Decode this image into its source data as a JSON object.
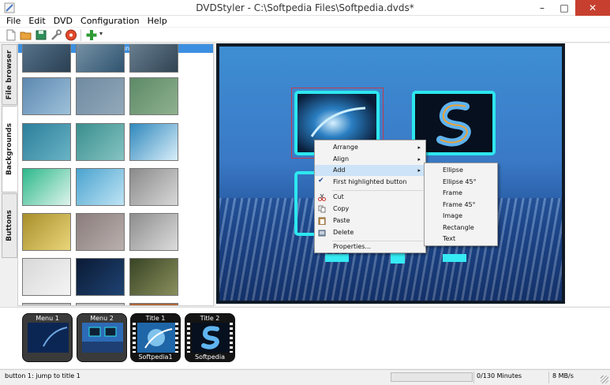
{
  "window": {
    "title": "DVDStyler - C:\\Softpedia Files\\Softpedia.dvds*",
    "minimize_glyph": "–",
    "maximize_glyph": "□",
    "close_glyph": "✕"
  },
  "menubar": [
    "File",
    "Edit",
    "DVD",
    "Configuration",
    "Help"
  ],
  "toolbar": {
    "icons": [
      "new-file-icon",
      "open-folder-icon",
      "save-icon",
      "wrench-icon",
      "burn-icon",
      "add-icon"
    ],
    "add_dropdown_glyph": "▾"
  },
  "side_tabs": [
    "File browser",
    "Backgrounds",
    "Buttons"
  ],
  "backgrounds_panel": {
    "header": "Backgrounds",
    "thumbnails": [
      {
        "colors": [
          "#5a7891",
          "#2a3f52"
        ]
      },
      {
        "colors": [
          "#7d97aa",
          "#2f5470"
        ]
      },
      {
        "colors": [
          "#6f8596",
          "#2f4353"
        ]
      },
      {
        "colors": [
          "#5d88b0",
          "#9ec1da"
        ]
      },
      {
        "colors": [
          "#6f8aa1",
          "#93a9ba"
        ]
      },
      {
        "colors": [
          "#5d8a67",
          "#8fb18e"
        ]
      },
      {
        "colors": [
          "#2c7f9c",
          "#69b3c4"
        ]
      },
      {
        "colors": [
          "#3a8e8e",
          "#86c4c3"
        ]
      },
      {
        "colors": [
          "#2f88bd",
          "#d9eef9"
        ]
      },
      {
        "colors": [
          "#2cb88a",
          "#dff4ec"
        ]
      },
      {
        "colors": [
          "#4aa3cf",
          "#bfe4f4"
        ]
      },
      {
        "colors": [
          "#8a8a8a",
          "#d8d8d8"
        ]
      },
      {
        "colors": [
          "#a88f2b",
          "#e9d57a"
        ]
      },
      {
        "colors": [
          "#8a7c7c",
          "#b9b0ad"
        ]
      },
      {
        "colors": [
          "#8d8d8d",
          "#dcdcdc"
        ]
      },
      {
        "colors": [
          "#d8d8d8",
          "#f4f4f4"
        ]
      },
      {
        "colors": [
          "#0b1a35",
          "#1e4372"
        ]
      },
      {
        "colors": [
          "#384424",
          "#8a8f5c"
        ]
      }
    ]
  },
  "context_menu": {
    "items": [
      {
        "label": "Arrange",
        "submenu": true
      },
      {
        "label": "Align",
        "submenu": true
      },
      {
        "label": "Add",
        "submenu": true,
        "highlighted": true
      },
      {
        "label": "First highlighted button",
        "checked": true
      },
      {
        "label": "Cut",
        "icon": "scissors-icon"
      },
      {
        "label": "Copy",
        "icon": "copy-icon"
      },
      {
        "label": "Paste",
        "icon": "paste-icon"
      },
      {
        "label": "Delete",
        "icon": "delete-icon"
      },
      {
        "label": "Properties..."
      }
    ],
    "submenu_glyph": "▸",
    "check_glyph": "✔"
  },
  "add_submenu": [
    "Ellipse",
    "Ellipse 45°",
    "Frame",
    "Frame 45°",
    "Image",
    "Rectangle",
    "Text"
  ],
  "titleset": [
    {
      "label": "Menu 1",
      "type": "menu"
    },
    {
      "label": "Menu 2",
      "type": "menu"
    },
    {
      "label": "Title 1",
      "type": "title",
      "caption": "Softpedia1"
    },
    {
      "label": "Title 2",
      "type": "title",
      "caption": "Softpedia"
    }
  ],
  "status": {
    "message": "button 1: jump to title 1",
    "minutes": "0/130 Minutes",
    "rate": "8 MB/s"
  },
  "colors": {
    "accent": "#3c8fe0",
    "button_frame": "#2de7ef",
    "close_button": "#c7402f",
    "menu_highlight": "#cde3f7"
  }
}
